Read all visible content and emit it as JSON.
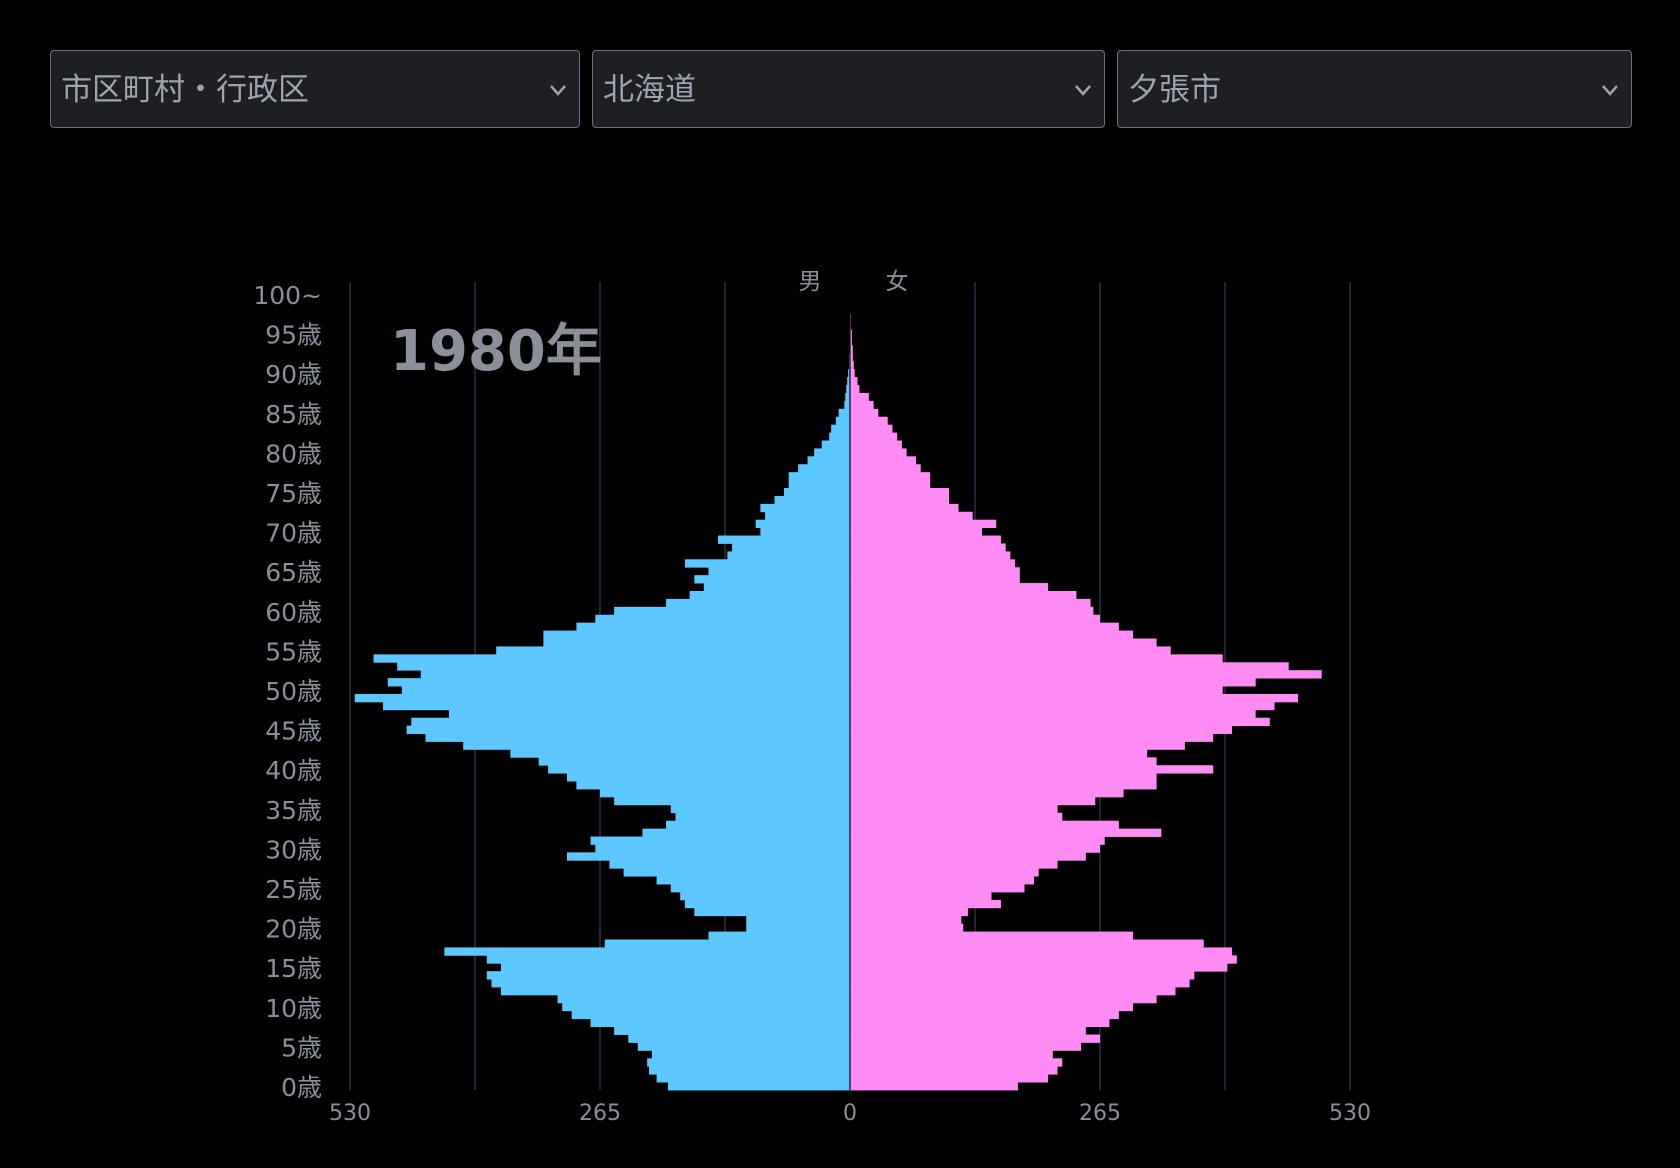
{
  "selects": [
    {
      "value": "市区町村・行政区",
      "icon": "chevron-down-icon"
    },
    {
      "value": "北海道",
      "icon": "chevron-down-icon"
    },
    {
      "value": "夕張市",
      "icon": "chevron-down-icon"
    }
  ],
  "colors": {
    "male": "#5cc8ff",
    "female": "#ff8cf5",
    "grid": "#2e3146",
    "text": "#8a8f9a",
    "year": "#8a8f9a"
  },
  "chart_data": {
    "type": "bar",
    "orientation": "horizontal",
    "title": "1980年",
    "legend": [
      "男",
      "女"
    ],
    "x_ticks": [
      "530",
      "265",
      "0",
      "265",
      "530"
    ],
    "xlim": [
      -530,
      530
    ],
    "y_tick_labels": [
      "0歳",
      "5歳",
      "10歳",
      "15歳",
      "20歳",
      "25歳",
      "30歳",
      "35歳",
      "40歳",
      "45歳",
      "50歳",
      "55歳",
      "60歳",
      "65歳",
      "70歳",
      "75歳",
      "80歳",
      "85歳",
      "90歳",
      "95歳",
      "100~"
    ],
    "age_bins": [
      "0",
      "1",
      "2",
      "3",
      "4",
      "5",
      "6",
      "7",
      "8",
      "9",
      "10",
      "11",
      "12",
      "13",
      "14",
      "15",
      "16",
      "17",
      "18",
      "19",
      "20",
      "21",
      "22",
      "23",
      "24",
      "25",
      "26",
      "27",
      "28",
      "29",
      "30",
      "31",
      "32",
      "33",
      "34",
      "35",
      "36",
      "37",
      "38",
      "39",
      "40",
      "41",
      "42",
      "43",
      "44",
      "45",
      "46",
      "47",
      "48",
      "49",
      "50",
      "51",
      "52",
      "53",
      "54",
      "55",
      "56",
      "57",
      "58",
      "59",
      "60",
      "61",
      "62",
      "63",
      "64",
      "65",
      "66",
      "67",
      "68",
      "69",
      "70",
      "71",
      "72",
      "73",
      "74",
      "75",
      "76",
      "77",
      "78",
      "79",
      "80",
      "81",
      "82",
      "83",
      "84",
      "85",
      "86",
      "87",
      "88",
      "89",
      "90",
      "91",
      "92",
      "93",
      "94",
      "95",
      "96",
      "97",
      "98",
      "99",
      "100~"
    ],
    "series": [
      {
        "name": "男",
        "values": [
          193,
          205,
          213,
          215,
          210,
          225,
          235,
          250,
          275,
          295,
          305,
          310,
          370,
          380,
          385,
          370,
          385,
          430,
          260,
          150,
          110,
          110,
          165,
          175,
          180,
          190,
          205,
          240,
          255,
          300,
          270,
          275,
          220,
          195,
          185,
          190,
          250,
          265,
          290,
          300,
          320,
          330,
          360,
          410,
          450,
          470,
          465,
          425,
          495,
          525,
          475,
          490,
          455,
          480,
          505,
          375,
          325,
          325,
          290,
          270,
          250,
          195,
          170,
          155,
          165,
          150,
          175,
          130,
          125,
          140,
          95,
          100,
          90,
          95,
          80,
          70,
          65,
          65,
          55,
          45,
          38,
          30,
          22,
          20,
          15,
          12,
          6,
          5,
          4,
          3,
          2,
          1,
          1,
          0,
          0,
          0,
          0,
          0,
          0,
          0,
          0
        ]
      },
      {
        "name": "女",
        "values": [
          178,
          210,
          220,
          225,
          215,
          245,
          265,
          250,
          275,
          285,
          300,
          325,
          345,
          360,
          365,
          400,
          410,
          405,
          375,
          300,
          120,
          118,
          125,
          160,
          150,
          185,
          195,
          200,
          220,
          250,
          265,
          270,
          330,
          285,
          225,
          220,
          260,
          290,
          325,
          325,
          385,
          325,
          315,
          355,
          385,
          405,
          445,
          430,
          450,
          475,
          395,
          430,
          500,
          465,
          395,
          340,
          325,
          300,
          285,
          265,
          258,
          255,
          240,
          210,
          180,
          180,
          175,
          170,
          165,
          160,
          140,
          155,
          130,
          115,
          105,
          105,
          85,
          85,
          75,
          70,
          60,
          55,
          50,
          45,
          40,
          30,
          25,
          20,
          10,
          8,
          5,
          4,
          3,
          3,
          2,
          2,
          1,
          1,
          0,
          0,
          0
        ]
      }
    ]
  }
}
